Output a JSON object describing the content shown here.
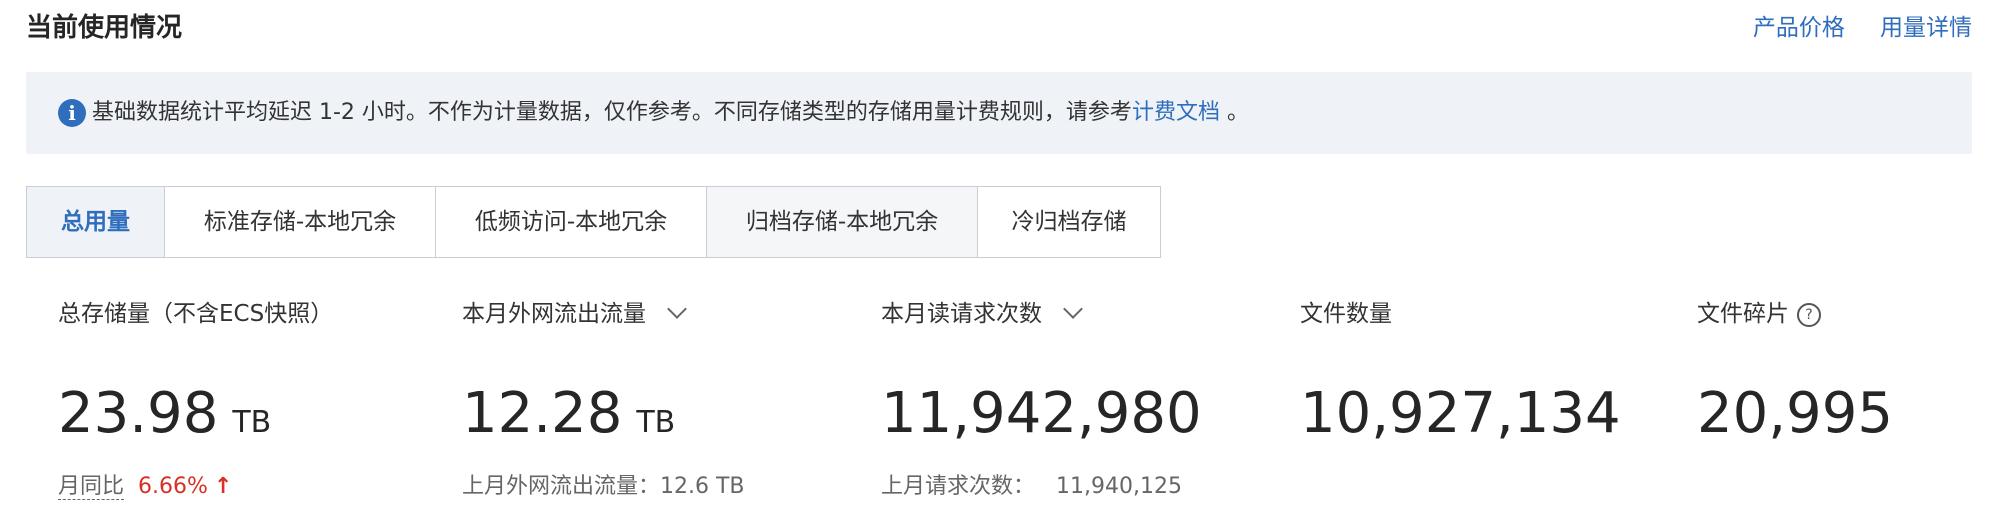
{
  "header": {
    "title": "当前使用情况",
    "links": [
      "产品价格",
      "用量详情"
    ]
  },
  "notice": {
    "icon": "info-icon",
    "text": "基础数据统计平均延迟 1-2 小时。不作为计量数据，仅作参考。不同存储类型的存储用量计费规则，请参考",
    "link": "计费文档",
    "suffix": " 。"
  },
  "tabs": [
    {
      "label": "总用量",
      "active": true
    },
    {
      "label": "标准存储-本地冗余"
    },
    {
      "label": "低频访问-本地冗余"
    },
    {
      "label": "归档存储-本地冗余"
    },
    {
      "label": "冷归档存储"
    }
  ],
  "stats": [
    {
      "label": "总存储量（不含ECS快照）",
      "value": "23.98",
      "unit": "TB",
      "sub_label": "月同比",
      "sub_value": "6.66%",
      "arrow": "↑"
    },
    {
      "label": "本月外网流出流量",
      "value": "12.28",
      "unit": "TB",
      "sub_label": "上月外网流出流量：",
      "sub_value": "12.6 TB"
    },
    {
      "label": "本月读请求次数",
      "value": "11,942,980",
      "sub_label": "上月请求次数：",
      "sub_value": "11,940,125"
    },
    {
      "label": "文件数量",
      "value": "10,927,134"
    },
    {
      "label": "文件碎片",
      "value": "20,995",
      "help": "?"
    }
  ],
  "colors": {
    "accent": "#2f6dbd",
    "notice_bg": "#eff3f8",
    "up": "#d93026"
  }
}
